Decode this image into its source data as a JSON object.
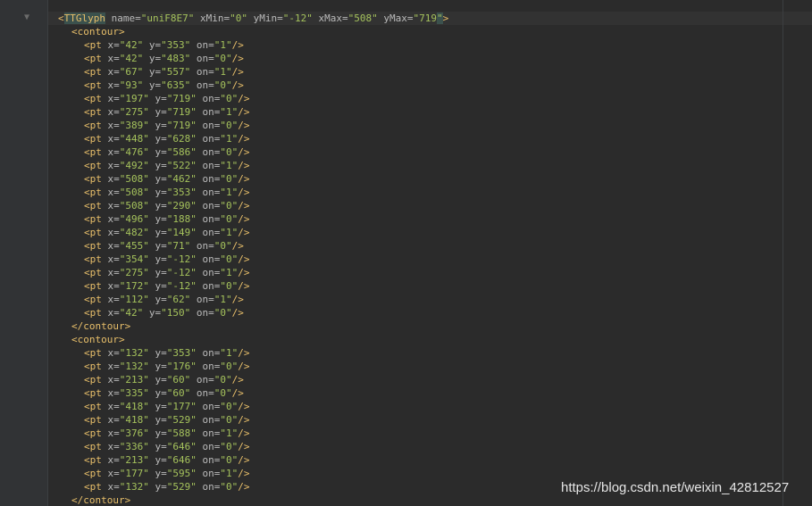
{
  "editor": {
    "glyph_open": {
      "tag": "TTGlyph",
      "attrs": [
        {
          "name": "name",
          "value": "uniF8E7"
        },
        {
          "name": "xMin",
          "value": "0"
        },
        {
          "name": "yMin",
          "value": "-12"
        },
        {
          "name": "xMax",
          "value": "508"
        },
        {
          "name": "yMax",
          "value": "719"
        }
      ]
    },
    "contour_open": "contour",
    "contour_close": "/contour",
    "pt_tag": "pt",
    "attr_x": "x",
    "attr_y": "y",
    "attr_on": "on",
    "contours": [
      {
        "points": [
          {
            "x": "42",
            "y": "353",
            "on": "1"
          },
          {
            "x": "42",
            "y": "483",
            "on": "0"
          },
          {
            "x": "67",
            "y": "557",
            "on": "1"
          },
          {
            "x": "93",
            "y": "635",
            "on": "0"
          },
          {
            "x": "197",
            "y": "719",
            "on": "0"
          },
          {
            "x": "275",
            "y": "719",
            "on": "1"
          },
          {
            "x": "389",
            "y": "719",
            "on": "0"
          },
          {
            "x": "448",
            "y": "628",
            "on": "1"
          },
          {
            "x": "476",
            "y": "586",
            "on": "0"
          },
          {
            "x": "492",
            "y": "522",
            "on": "1"
          },
          {
            "x": "508",
            "y": "462",
            "on": "0"
          },
          {
            "x": "508",
            "y": "353",
            "on": "1"
          },
          {
            "x": "508",
            "y": "290",
            "on": "0"
          },
          {
            "x": "496",
            "y": "188",
            "on": "0"
          },
          {
            "x": "482",
            "y": "149",
            "on": "1"
          },
          {
            "x": "455",
            "y": "71",
            "on": "0"
          },
          {
            "x": "354",
            "y": "-12",
            "on": "0"
          },
          {
            "x": "275",
            "y": "-12",
            "on": "1"
          },
          {
            "x": "172",
            "y": "-12",
            "on": "0"
          },
          {
            "x": "112",
            "y": "62",
            "on": "1"
          },
          {
            "x": "42",
            "y": "150",
            "on": "0"
          }
        ]
      },
      {
        "points": [
          {
            "x": "132",
            "y": "353",
            "on": "1"
          },
          {
            "x": "132",
            "y": "176",
            "on": "0"
          },
          {
            "x": "213",
            "y": "60",
            "on": "0"
          },
          {
            "x": "335",
            "y": "60",
            "on": "0"
          },
          {
            "x": "418",
            "y": "177",
            "on": "0"
          },
          {
            "x": "418",
            "y": "529",
            "on": "0"
          },
          {
            "x": "376",
            "y": "588",
            "on": "1"
          },
          {
            "x": "336",
            "y": "646",
            "on": "0"
          },
          {
            "x": "213",
            "y": "646",
            "on": "0"
          },
          {
            "x": "177",
            "y": "595",
            "on": "1"
          },
          {
            "x": "132",
            "y": "529",
            "on": "0"
          }
        ]
      }
    ]
  },
  "watermark": "https://blog.csdn.net/weixin_42812527",
  "icons": {
    "fold": "fold-marker-icon"
  },
  "colors": {
    "background": "#2b2b2b",
    "tag": "#e8bf6a",
    "attribute": "#bababa",
    "value": "#a5c25c"
  }
}
